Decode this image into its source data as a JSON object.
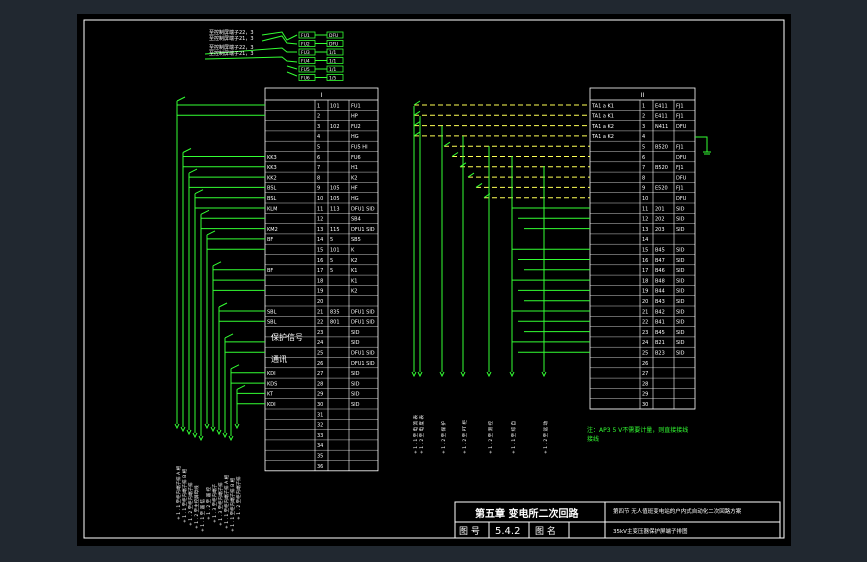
{
  "titleblock": {
    "chapter_title": "第五章  变电所二次回路",
    "description": "第四节  无人值班变电站的户内式自动化二次回路方案",
    "figno_label": "图  号",
    "figno_value": "5.4.2",
    "figname_label": "图  名",
    "figname_value": "35kV主变压器保护屏端子排图"
  },
  "note": {
    "line1": "注：AP3 5 V不需要计量，则直接接线",
    "line2": "接线"
  },
  "terminal_blocks": {
    "left": {
      "header": "I",
      "extra_labels": [
        "保护信号",
        "通讯"
      ],
      "rows": [
        {
          "left": "",
          "num": "1",
          "mid": "101",
          "right": "FU1"
        },
        {
          "left": "",
          "num": "2",
          "mid": "",
          "right": "HP"
        },
        {
          "left": "",
          "num": "3",
          "mid": "102",
          "right": "FU2"
        },
        {
          "left": "",
          "num": "4",
          "mid": "",
          "right": "HG"
        },
        {
          "left": "",
          "num": "5",
          "mid": "",
          "right": "FU5 HI"
        },
        {
          "left": "KK3",
          "num": "6",
          "mid": "",
          "right": "FU6"
        },
        {
          "left": "KK3",
          "num": "7",
          "mid": "",
          "right": "H1"
        },
        {
          "left": "KK2",
          "num": "8",
          "mid": "",
          "right": "K2"
        },
        {
          "left": "BSL",
          "num": "9",
          "mid": "105",
          "right": "HF"
        },
        {
          "left": "BSL",
          "num": "10",
          "mid": "105",
          "right": "HG"
        },
        {
          "left": "KLM",
          "num": "11",
          "mid": "113",
          "right": "DFU1 SID"
        },
        {
          "left": "",
          "num": "12",
          "mid": "",
          "right": "SB4"
        },
        {
          "left": "KM2",
          "num": "13",
          "mid": "115",
          "right": "DFU1 SID"
        },
        {
          "left": "BF",
          "num": "14",
          "mid": "5",
          "right": "SB5"
        },
        {
          "left": "",
          "num": "15",
          "mid": "101",
          "right": "K"
        },
        {
          "left": "",
          "num": "16",
          "mid": "5",
          "right": "K2"
        },
        {
          "left": "BF",
          "num": "17",
          "mid": "5",
          "right": "K1"
        },
        {
          "left": "",
          "num": "18",
          "mid": "",
          "right": "K1"
        },
        {
          "left": "",
          "num": "19",
          "mid": "",
          "right": "K2"
        },
        {
          "left": "",
          "num": "20",
          "mid": "",
          "right": ""
        },
        {
          "left": "SBL",
          "num": "21",
          "mid": "835",
          "right": "DFU1 SID"
        },
        {
          "left": "SBL",
          "num": "22",
          "mid": "801",
          "right": "DFU1 SID"
        },
        {
          "left": "",
          "num": "23",
          "mid": "",
          "right": "SID"
        },
        {
          "left": "",
          "num": "24",
          "mid": "",
          "right": "SID"
        },
        {
          "left": "",
          "num": "25",
          "mid": "",
          "right": "DFU1 SID"
        },
        {
          "left": "",
          "num": "26",
          "mid": "",
          "right": "DFU1 SID"
        },
        {
          "left": "KDI",
          "num": "27",
          "mid": "",
          "right": "SID"
        },
        {
          "left": "KDS",
          "num": "28",
          "mid": "",
          "right": "SID"
        },
        {
          "left": "KT",
          "num": "29",
          "mid": "",
          "right": "SID"
        },
        {
          "left": "KDI",
          "num": "30",
          "mid": "",
          "right": "SID"
        },
        {
          "left": "",
          "num": "31",
          "mid": "",
          "right": ""
        },
        {
          "left": "",
          "num": "32",
          "mid": "",
          "right": ""
        },
        {
          "left": "",
          "num": "33",
          "mid": "",
          "right": ""
        },
        {
          "left": "",
          "num": "34",
          "mid": "",
          "right": ""
        },
        {
          "left": "",
          "num": "35",
          "mid": "",
          "right": ""
        },
        {
          "left": "",
          "num": "36",
          "mid": "",
          "right": ""
        }
      ]
    },
    "right": {
      "header": "II",
      "rows": [
        {
          "left": "TA1 a K1",
          "num": "1",
          "mid": "E411",
          "right": "FJ1"
        },
        {
          "left": "TA1 a K1",
          "num": "2",
          "mid": "E411",
          "right": "FJ1"
        },
        {
          "left": "TA1 a K2",
          "num": "3",
          "mid": "N411",
          "right": "DFU"
        },
        {
          "left": "TA1 a K2",
          "num": "4",
          "mid": "",
          "right": ""
        },
        {
          "left": "",
          "num": "5",
          "mid": "B520",
          "right": "FJ1"
        },
        {
          "left": "",
          "num": "6",
          "mid": "",
          "right": "DFU"
        },
        {
          "left": "",
          "num": "7",
          "mid": "B520",
          "right": "FJ1"
        },
        {
          "left": "",
          "num": "8",
          "mid": "",
          "right": "DFU"
        },
        {
          "left": "",
          "num": "9",
          "mid": "E520",
          "right": "FJ1"
        },
        {
          "left": "",
          "num": "10",
          "mid": "",
          "right": "DFU"
        },
        {
          "left": "",
          "num": "11",
          "mid": "201",
          "right": "SID"
        },
        {
          "left": "",
          "num": "12",
          "mid": "202",
          "right": "SID"
        },
        {
          "left": "",
          "num": "13",
          "mid": "203",
          "right": "SID"
        },
        {
          "left": "",
          "num": "14",
          "mid": "",
          "right": ""
        },
        {
          "left": "",
          "num": "15",
          "mid": "B45",
          "right": "SID"
        },
        {
          "left": "",
          "num": "16",
          "mid": "B47",
          "right": "SID"
        },
        {
          "left": "",
          "num": "17",
          "mid": "B46",
          "right": "SID"
        },
        {
          "left": "",
          "num": "18",
          "mid": "B48",
          "right": "SID"
        },
        {
          "left": "",
          "num": "19",
          "mid": "B44",
          "right": "SID"
        },
        {
          "left": "",
          "num": "20",
          "mid": "B43",
          "right": "SID"
        },
        {
          "left": "",
          "num": "21",
          "mid": "B42",
          "right": "SID"
        },
        {
          "left": "",
          "num": "22",
          "mid": "B41",
          "right": "SID"
        },
        {
          "left": "",
          "num": "23",
          "mid": "B45",
          "right": "SID"
        },
        {
          "left": "",
          "num": "24",
          "mid": "B21",
          "right": "SID"
        },
        {
          "left": "",
          "num": "25",
          "mid": "B23",
          "right": "SID"
        },
        {
          "left": "",
          "num": "26",
          "mid": "",
          "right": ""
        },
        {
          "left": "",
          "num": "27",
          "mid": "",
          "right": ""
        },
        {
          "left": "",
          "num": "28",
          "mid": "",
          "right": ""
        },
        {
          "left": "",
          "num": "29",
          "mid": "",
          "right": ""
        },
        {
          "left": "",
          "num": "30",
          "mid": "",
          "right": ""
        }
      ]
    }
  },
  "fuses": {
    "labels": [
      "FU1",
      "FU2",
      "FU3",
      "FU4",
      "FU5",
      "FU6"
    ],
    "right_labels": [
      "DFU",
      "DFU",
      "1/1",
      "1/1",
      "1/1",
      "1/5"
    ],
    "supply_labels": [
      "至控制屏端子22，3",
      "至控制屏端子21，3",
      "至控制屏端子22，3",
      "至控制屏端子21，3"
    ]
  },
  "cable_labels": {
    "left": [
      "+ 1 . 1 至柜内端子排 A 相",
      "+ 1 . 1 至柜内端子排 B 相",
      "+ 1 . 2 至柜内端子排",
      "+ 1 . 2 至主控屏母线",
      "+ 1 . 1 至 遥 信",
      "+ 1 . 2 至 遥 控",
      "+ 1 . 3 至柜内端子",
      "+ 1 . 3 至柜内端子排"
    ],
    "right": [
      "+ 1 . 1 至 电 流 表",
      "+ 1 . 2 至 电 度 表",
      "+ 1 . 2 至 保 护",
      "+ 1 . 2 至 PT 柜",
      "+ 1 . 2 至 测 控",
      "+ 1 . 1 至 综 自",
      "+ 1 . 2 至 远 动"
    ]
  }
}
